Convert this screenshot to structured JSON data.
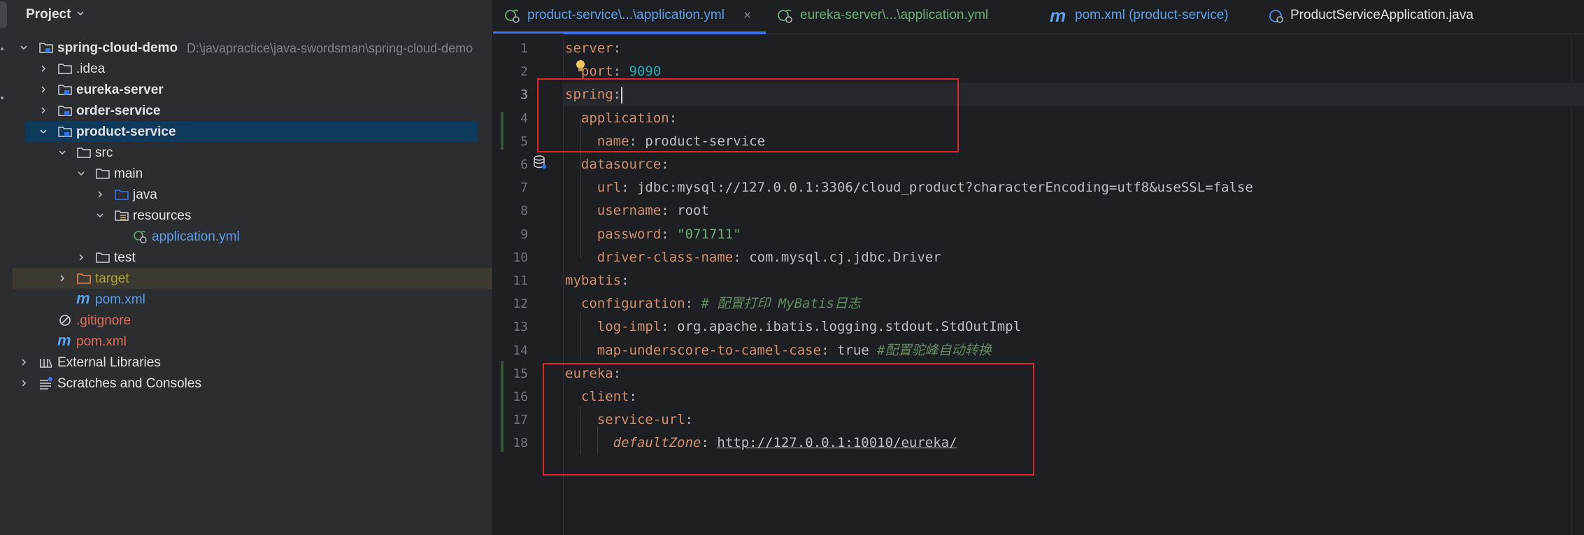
{
  "project_panel": {
    "title": "Project",
    "tree": [
      {
        "label": "spring-cloud-demo",
        "path": "D:\\javapractice\\java-swordsman\\spring-cloud-demo",
        "icon": "module-folder-icon"
      },
      {
        "label": ".idea",
        "icon": "folder-icon"
      },
      {
        "label": "eureka-server",
        "icon": "module-folder-icon"
      },
      {
        "label": "order-service",
        "icon": "module-folder-icon"
      },
      {
        "label": "product-service",
        "icon": "module-folder-icon"
      },
      {
        "label": "src",
        "icon": "folder-icon"
      },
      {
        "label": "main",
        "icon": "folder-icon"
      },
      {
        "label": "java",
        "icon": "source-folder-icon"
      },
      {
        "label": "resources",
        "icon": "resources-folder-icon"
      },
      {
        "label": "application.yml",
        "icon": "spring-yml-icon"
      },
      {
        "label": "test",
        "icon": "folder-icon"
      },
      {
        "label": "target",
        "icon": "excluded-folder-icon"
      },
      {
        "label": "pom.xml",
        "icon": "maven-icon"
      },
      {
        "label": ".gitignore",
        "icon": "ignore-icon"
      },
      {
        "label": "pom.xml",
        "icon": "maven-icon"
      },
      {
        "label": "External Libraries",
        "icon": "library-icon"
      },
      {
        "label": "Scratches and Consoles",
        "icon": "scratches-icon"
      }
    ]
  },
  "tabs": [
    {
      "label": "product-service\\...\\application.yml",
      "icon": "spring-yml-icon",
      "active": true,
      "close": "×"
    },
    {
      "label": "eureka-server\\...\\application.yml",
      "icon": "spring-yml-icon",
      "active": false
    },
    {
      "label": "pom.xml (product-service)",
      "icon": "maven-icon",
      "active": false
    },
    {
      "label": "ProductServiceApplication.java",
      "icon": "spring-boot-class-icon",
      "active": false
    }
  ],
  "editor": {
    "current_line": 3,
    "lines": [
      {
        "num": "1",
        "tokens": [
          {
            "t": "server",
            "c": "k"
          },
          {
            "t": ":",
            "c": "p"
          }
        ]
      },
      {
        "num": "2",
        "tokens": [
          {
            "t": "  ",
            "c": "p"
          },
          {
            "t": "port",
            "c": "k"
          },
          {
            "t": ": ",
            "c": "p"
          },
          {
            "t": "9090",
            "c": "n"
          }
        ]
      },
      {
        "num": "3",
        "tokens": [
          {
            "t": "spring",
            "c": "k"
          },
          {
            "t": ":",
            "c": "p"
          }
        ]
      },
      {
        "num": "4",
        "tokens": [
          {
            "t": "  ",
            "c": "p"
          },
          {
            "t": "application",
            "c": "k"
          },
          {
            "t": ":",
            "c": "p"
          }
        ]
      },
      {
        "num": "5",
        "tokens": [
          {
            "t": "    ",
            "c": "p"
          },
          {
            "t": "name",
            "c": "k"
          },
          {
            "t": ": ",
            "c": "p"
          },
          {
            "t": "product-service",
            "c": "v"
          }
        ]
      },
      {
        "num": "6",
        "tokens": [
          {
            "t": "  ",
            "c": "p"
          },
          {
            "t": "datasource",
            "c": "k"
          },
          {
            "t": ":",
            "c": "p"
          }
        ]
      },
      {
        "num": "7",
        "tokens": [
          {
            "t": "    ",
            "c": "p"
          },
          {
            "t": "url",
            "c": "k"
          },
          {
            "t": ": ",
            "c": "p"
          },
          {
            "t": "jdbc:mysql://127.0.0.1:3306/cloud_product?characterEncoding=utf8&useSSL=false",
            "c": "v"
          }
        ]
      },
      {
        "num": "8",
        "tokens": [
          {
            "t": "    ",
            "c": "p"
          },
          {
            "t": "username",
            "c": "k"
          },
          {
            "t": ": ",
            "c": "p"
          },
          {
            "t": "root",
            "c": "v"
          }
        ]
      },
      {
        "num": "9",
        "tokens": [
          {
            "t": "    ",
            "c": "p"
          },
          {
            "t": "password",
            "c": "k"
          },
          {
            "t": ": ",
            "c": "p"
          },
          {
            "t": "\"071711\"",
            "c": "s"
          }
        ]
      },
      {
        "num": "10",
        "tokens": [
          {
            "t": "    ",
            "c": "p"
          },
          {
            "t": "driver-class-name",
            "c": "k"
          },
          {
            "t": ": ",
            "c": "p"
          },
          {
            "t": "com.mysql.cj.jdbc.Driver",
            "c": "v"
          }
        ]
      },
      {
        "num": "11",
        "tokens": [
          {
            "t": "mybatis",
            "c": "k"
          },
          {
            "t": ":",
            "c": "p"
          }
        ]
      },
      {
        "num": "12",
        "tokens": [
          {
            "t": "  ",
            "c": "p"
          },
          {
            "t": "configuration",
            "c": "k"
          },
          {
            "t": ": ",
            "c": "p"
          },
          {
            "t": "# 配置打印 MyBatis日志",
            "c": "cg"
          }
        ]
      },
      {
        "num": "13",
        "tokens": [
          {
            "t": "    ",
            "c": "p"
          },
          {
            "t": "log-impl",
            "c": "k"
          },
          {
            "t": ": ",
            "c": "p"
          },
          {
            "t": "org.apache.ibatis.logging.stdout.StdOutImpl",
            "c": "v"
          }
        ]
      },
      {
        "num": "14",
        "tokens": [
          {
            "t": "    ",
            "c": "p"
          },
          {
            "t": "map-underscore-to-camel-case",
            "c": "k"
          },
          {
            "t": ": ",
            "c": "p"
          },
          {
            "t": "true",
            "c": "v"
          },
          {
            "t": " ",
            "c": "p"
          },
          {
            "t": "#配置驼峰自动转换",
            "c": "cg"
          }
        ]
      },
      {
        "num": "15",
        "tokens": [
          {
            "t": "eureka",
            "c": "k"
          },
          {
            "t": ":",
            "c": "p"
          }
        ]
      },
      {
        "num": "16",
        "tokens": [
          {
            "t": "  ",
            "c": "p"
          },
          {
            "t": "client",
            "c": "k"
          },
          {
            "t": ":",
            "c": "p"
          }
        ]
      },
      {
        "num": "17",
        "tokens": [
          {
            "t": "    ",
            "c": "p"
          },
          {
            "t": "service-url",
            "c": "k"
          },
          {
            "t": ":",
            "c": "p"
          }
        ]
      },
      {
        "num": "18",
        "tokens": [
          {
            "t": "      ",
            "c": "p"
          },
          {
            "t": "defaultZone",
            "c": "ki"
          },
          {
            "t": ": ",
            "c": "p"
          },
          {
            "t": "http://127.0.0.1:10010/eureka/",
            "c": "u"
          }
        ]
      }
    ]
  },
  "colors": {
    "annotation_box": "#e0242d",
    "selection": "#0e3a5b",
    "key": "#cf8e6d",
    "string": "#6aab73",
    "number": "#2aacb8",
    "link": "#5c9fe8"
  }
}
